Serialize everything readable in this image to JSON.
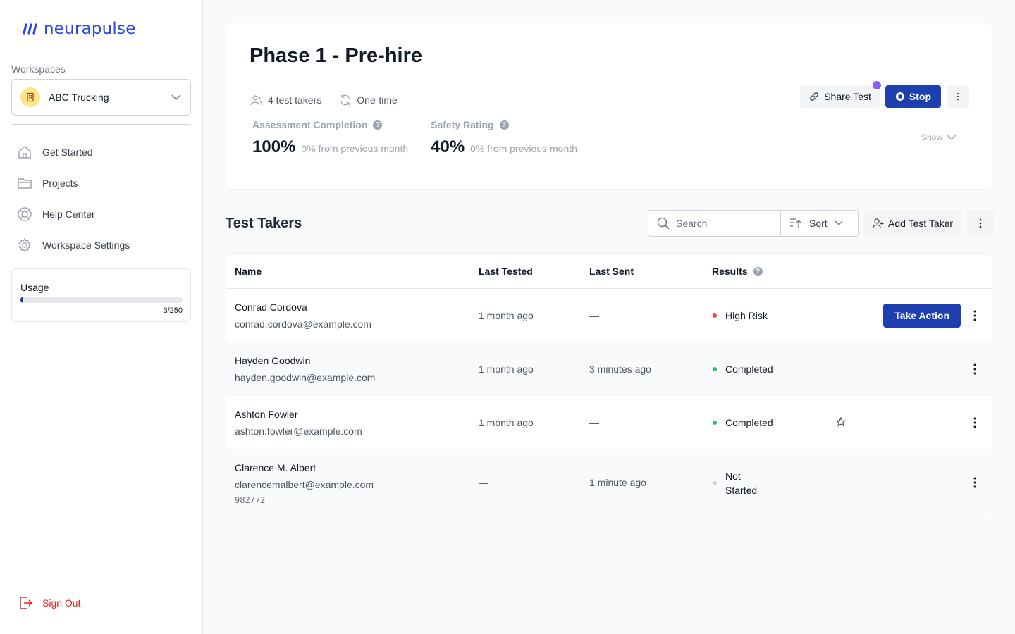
{
  "brand": {
    "name": "neurapulse",
    "color": "#2b4ae0"
  },
  "sidebar": {
    "workspaces_label": "Workspaces",
    "workspace_name": "ABC Trucking",
    "nav": [
      {
        "label": "Get Started",
        "icon": "home-icon"
      },
      {
        "label": "Projects",
        "icon": "folder-icon"
      },
      {
        "label": "Help Center",
        "icon": "lifebuoy-icon"
      },
      {
        "label": "Workspace Settings",
        "icon": "gear-icon"
      }
    ],
    "usage": {
      "title": "Usage",
      "count": "3/250",
      "used": 3,
      "total": 250
    },
    "sign_out": "Sign Out"
  },
  "project": {
    "title": "Phase 1 - Pre-hire",
    "test_takers": "4 test takers",
    "frequency": "One-time",
    "stats": [
      {
        "label": "Assessment Completion",
        "value": "100%",
        "change": "0% from previous month"
      },
      {
        "label": "Safety Rating",
        "value": "40%",
        "change": "0% from previous month"
      }
    ],
    "share_label": "Share Test",
    "stop_label": "Stop",
    "show_label": "Show"
  },
  "test_takers": {
    "title": "Test Takers",
    "search_placeholder": "Search",
    "sort_label": "Sort",
    "add_label": "Add Test Taker",
    "columns": [
      "Name",
      "Last Tested",
      "Last Sent",
      "Results"
    ],
    "rows": [
      {
        "name": "Conrad Cordova",
        "email": "conrad.cordova@example.com",
        "last_tested": "1 month ago",
        "last_sent": "—",
        "result": "High Risk",
        "result_color": "#ef4444",
        "action": "Take Action"
      },
      {
        "name": "Hayden Goodwin",
        "email": "hayden.goodwin@example.com",
        "last_tested": "1 month ago",
        "last_sent": "3 minutes ago",
        "result": "Completed",
        "result_color": "#22c55e"
      },
      {
        "name": "Ashton Fowler",
        "email": "ashton.fowler@example.com",
        "last_tested": "1 month ago",
        "last_sent": "—",
        "result": "Completed",
        "result_color": "#22c55e"
      },
      {
        "name": "Clarence M. Albert",
        "email": "clarencemalbert@example.com",
        "extra": "982772",
        "last_tested": "—",
        "last_sent": "1 minute ago",
        "result_line1": "Not",
        "result_line2": "Started",
        "result_color": "#d1d5db"
      }
    ]
  }
}
